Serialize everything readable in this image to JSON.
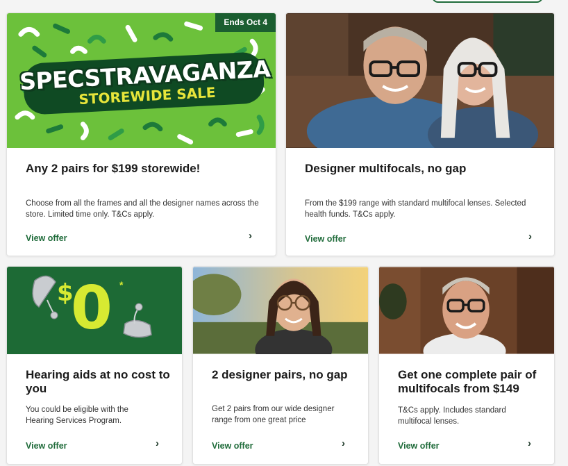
{
  "cards": [
    {
      "badge": "Ends Oct 4",
      "image_text_line1": "SPECSTRAVAGANZA",
      "image_text_line2": "STOREWIDE SALE",
      "title": "Any 2 pairs for $199 storewide!",
      "description": "Choose from all the frames and all the designer names across the store. Limited time only. T&Cs apply.",
      "link": "View offer",
      "chevron": "›"
    },
    {
      "title": "Designer multifocals, no gap",
      "description": "From the $199 range with standard multifocal lenses. Selected health funds. T&Cs apply.",
      "link": "View offer",
      "chevron": "›"
    },
    {
      "image_dollar": "$",
      "image_zero": "0",
      "image_star": "*",
      "title": "Hearing aids at no cost to you",
      "description": "You could be eligible with the Hearing Services Program.",
      "link": "View offer",
      "chevron": "›"
    },
    {
      "title": "2 designer pairs, no gap",
      "description": "Get 2 pairs from our wide designer range from one great price",
      "link": "View offer",
      "chevron": "›"
    },
    {
      "title": "Get one complete pair of multifocals from $149",
      "description": "T&Cs apply. Includes standard multifocal lenses.",
      "link": "View offer",
      "chevron": "›"
    }
  ],
  "colors": {
    "brand_green": "#1f6b3a",
    "promo_green": "#6cc13b",
    "accent_yellow": "#d7ea32"
  }
}
